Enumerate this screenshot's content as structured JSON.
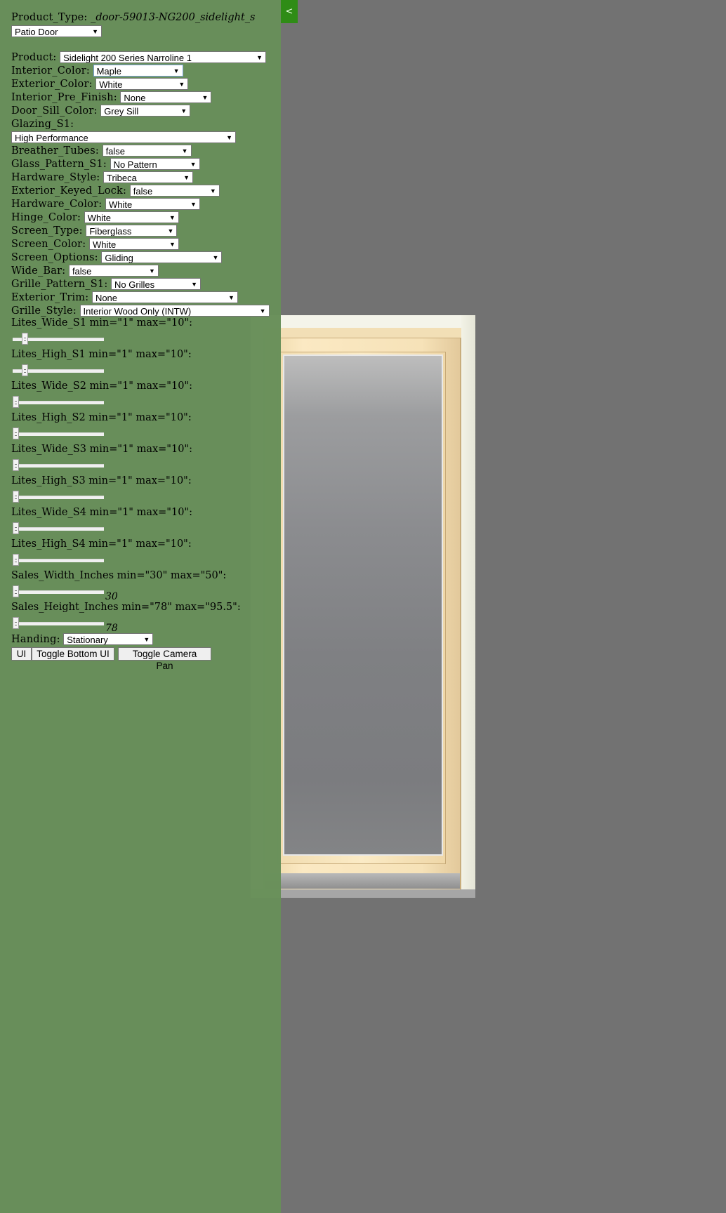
{
  "panel": {
    "collapse_label": "<",
    "product_type": {
      "label": "Product_Type:",
      "value": "_door-59013-NG200_sidelight_s",
      "select": "Patio Door"
    },
    "fields": [
      {
        "label": "Product:",
        "value": "Sidelight 200 Series Narroline 1"
      },
      {
        "label": "Interior_Color:",
        "value": "Maple"
      },
      {
        "label": "Exterior_Color:",
        "value": "White"
      },
      {
        "label": "Interior_Pre_Finish:",
        "value": "None"
      },
      {
        "label": "Door_Sill_Color:",
        "value": "Grey Sill"
      },
      {
        "label": "Glazing_S1:",
        "value": "High Performance"
      },
      {
        "label": "Breather_Tubes:",
        "value": "false"
      },
      {
        "label": "Glass_Pattern_S1:",
        "value": "No Pattern"
      },
      {
        "label": "Hardware_Style:",
        "value": "Tribeca"
      },
      {
        "label": "Exterior_Keyed_Lock:",
        "value": "false"
      },
      {
        "label": "Hardware_Color:",
        "value": "White"
      },
      {
        "label": "Hinge_Color:",
        "value": "White"
      },
      {
        "label": "Screen_Type:",
        "value": "Fiberglass"
      },
      {
        "label": "Screen_Color:",
        "value": "White"
      },
      {
        "label": "Screen_Options:",
        "value": "Gliding"
      },
      {
        "label": "Wide_Bar:",
        "value": "false"
      },
      {
        "label": "Grille_Pattern_S1:",
        "value": "No Grilles"
      },
      {
        "label": "Exterior_Trim:",
        "value": "None"
      },
      {
        "label": "Grille_Style:",
        "value": "Interior Wood Only (INTW)"
      }
    ],
    "sliders": [
      {
        "label": "Lites_Wide_S1 min=\"1\" max=\"10\":",
        "min": 1,
        "max": 10,
        "value": 2,
        "readout": ""
      },
      {
        "label": "Lites_High_S1 min=\"1\" max=\"10\":",
        "min": 1,
        "max": 10,
        "value": 2,
        "readout": ""
      },
      {
        "label": "Lites_Wide_S2 min=\"1\" max=\"10\":",
        "min": 1,
        "max": 10,
        "value": 1,
        "readout": ""
      },
      {
        "label": "Lites_High_S2 min=\"1\" max=\"10\":",
        "min": 1,
        "max": 10,
        "value": 1,
        "readout": ""
      },
      {
        "label": "Lites_Wide_S3 min=\"1\" max=\"10\":",
        "min": 1,
        "max": 10,
        "value": 1,
        "readout": ""
      },
      {
        "label": "Lites_High_S3 min=\"1\" max=\"10\":",
        "min": 1,
        "max": 10,
        "value": 1,
        "readout": ""
      },
      {
        "label": "Lites_Wide_S4 min=\"1\" max=\"10\":",
        "min": 1,
        "max": 10,
        "value": 1,
        "readout": ""
      },
      {
        "label": "Lites_High_S4 min=\"1\" max=\"10\":",
        "min": 1,
        "max": 10,
        "value": 1,
        "readout": ""
      },
      {
        "label": "Sales_Width_Inches min=\"30\" max=\"50\":",
        "min": 30,
        "max": 50,
        "value": 30,
        "readout": "30"
      },
      {
        "label": "Sales_Height_Inches min=\"78\" max=\"95.5\":",
        "min": 78,
        "max": 95.5,
        "value": 78,
        "readout": "78"
      }
    ],
    "handing": {
      "label": "Handing:",
      "value": "Stationary"
    },
    "buttons": {
      "ui": "UI",
      "toggle_bottom": "Toggle Bottom UI",
      "toggle_camera": "Toggle Camera Pan"
    }
  },
  "colors": {
    "panel_bg": "#688f5a",
    "viewport_bg": "#727272",
    "collapse_bg": "#2f8c16"
  }
}
